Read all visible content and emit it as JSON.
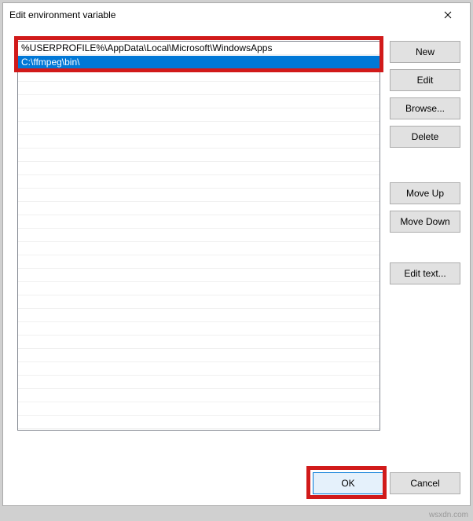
{
  "dialog": {
    "title": "Edit environment variable"
  },
  "list": {
    "items": [
      "%USERPROFILE%\\AppData\\Local\\Microsoft\\WindowsApps"
    ],
    "editing_value": "C:\\ffmpeg\\bin\\"
  },
  "buttons": {
    "new": "New",
    "edit": "Edit",
    "browse": "Browse...",
    "delete": "Delete",
    "move_up": "Move Up",
    "move_down": "Move Down",
    "edit_text": "Edit text...",
    "ok": "OK",
    "cancel": "Cancel"
  },
  "watermark": "wsxdn.com"
}
